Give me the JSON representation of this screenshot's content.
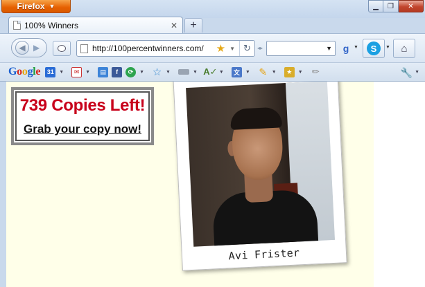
{
  "browser": {
    "menu_button_label": "Firefox",
    "window_controls": [
      "minimize",
      "restore",
      "close"
    ]
  },
  "tabs": [
    {
      "title": "100% Winners"
    }
  ],
  "navigation": {
    "url": "http://100percentwinners.com/",
    "search_value": ""
  },
  "page": {
    "promo": {
      "copies_left": "739 Copies Left!",
      "cta": "Grab your copy now!"
    },
    "photo_caption": "Avi Frister"
  },
  "colors": {
    "firefox_orange": "#e66000",
    "promo_red": "#c8001b",
    "page_background": "#ffffe9"
  }
}
